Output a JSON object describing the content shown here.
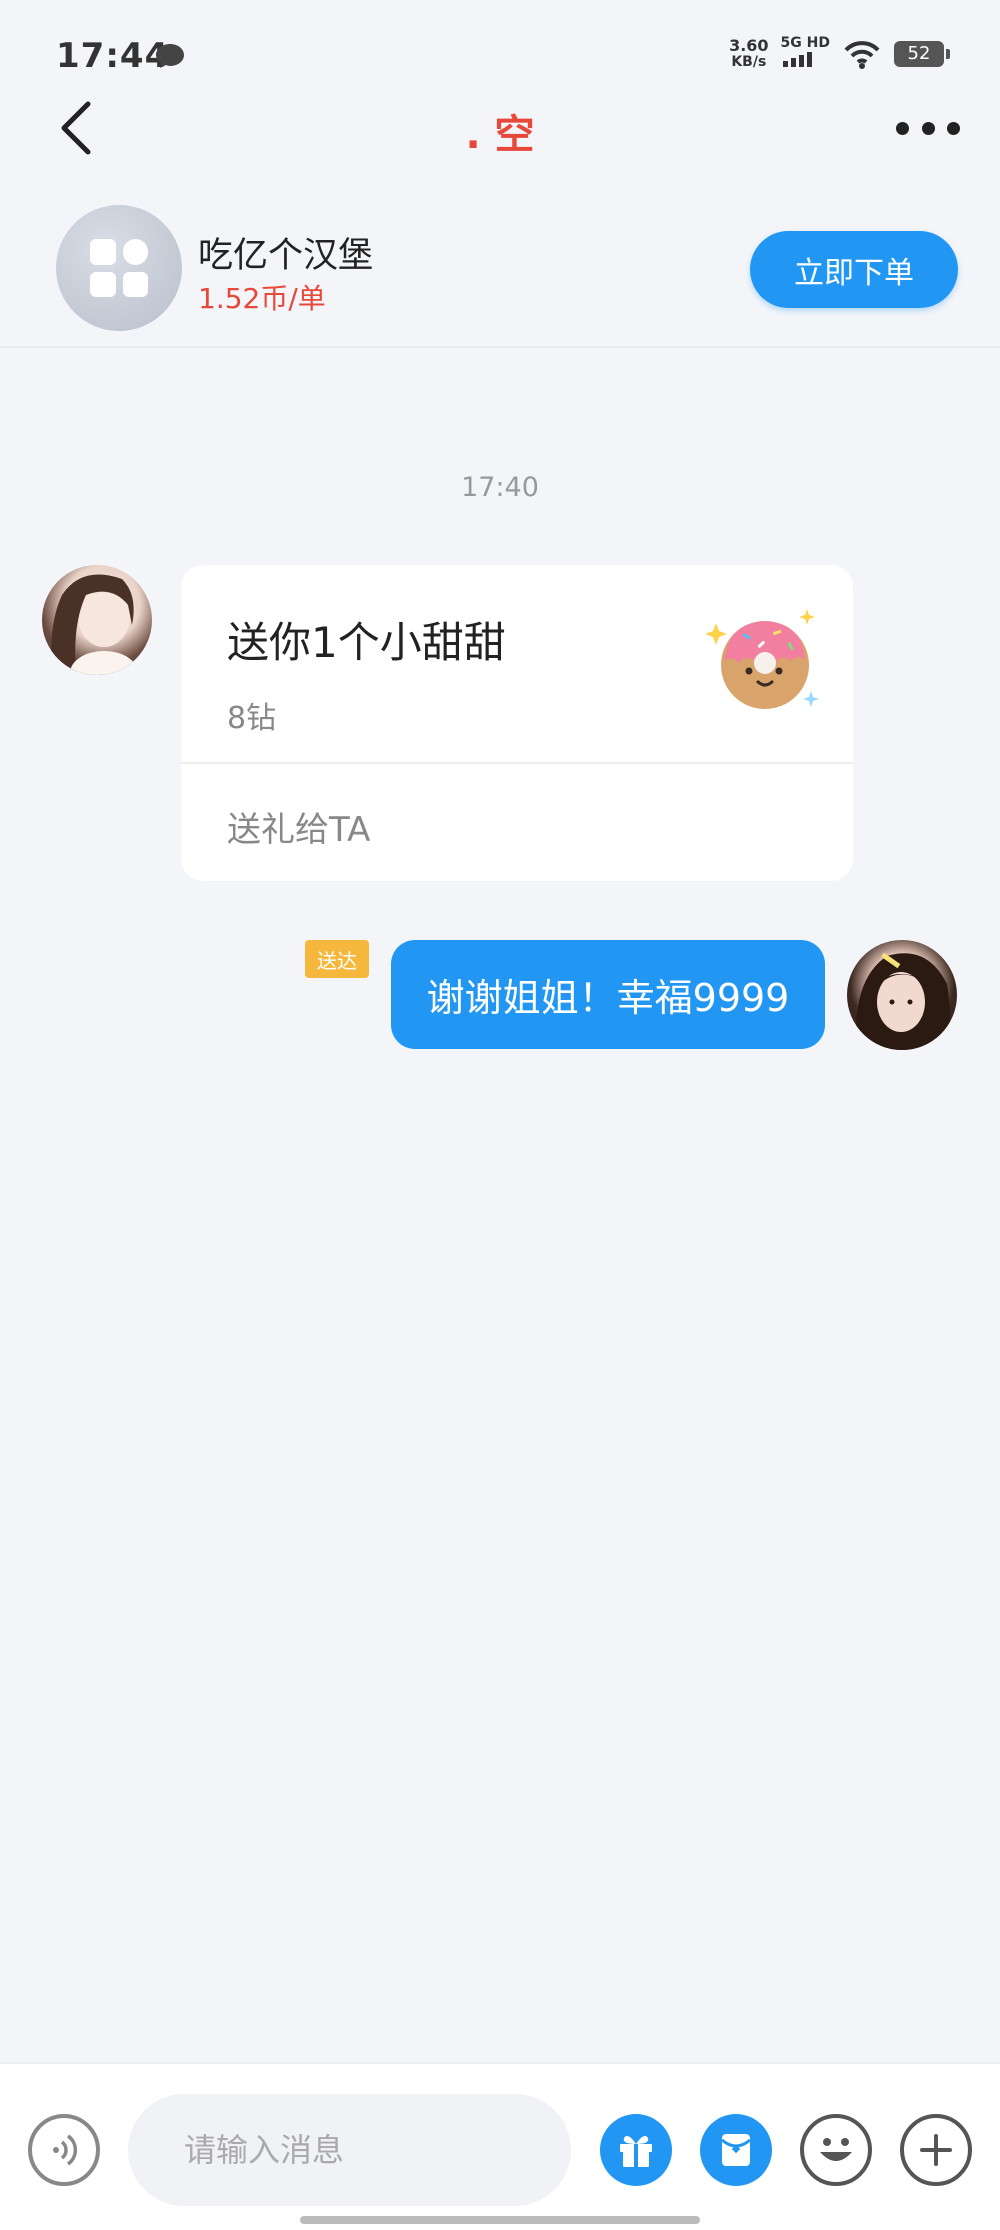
{
  "status_bar": {
    "time": "17:44",
    "net_speed_value": "3.60",
    "net_speed_unit": "KB/s",
    "net_type": "5G HD",
    "battery": "52"
  },
  "nav": {
    "title": ". 空"
  },
  "order": {
    "service_name": "吃亿个汉堡",
    "price": "1.52币/单",
    "order_button": "立即下单"
  },
  "chat": {
    "time_divider": "17:40",
    "gift_card": {
      "title": "送你1个小甜甜",
      "price": "8钻",
      "action": "送礼给TA",
      "image_icon": "donut-gift-icon"
    },
    "outgoing": {
      "status": "送达",
      "text": "谢谢姐姐！幸福9999"
    }
  },
  "input_bar": {
    "placeholder": "请输入消息"
  },
  "colors": {
    "accent": "#2196f3",
    "title_red": "#e8483a",
    "delivered_badge": "#f6b83c",
    "background": "#f3f5f9"
  }
}
